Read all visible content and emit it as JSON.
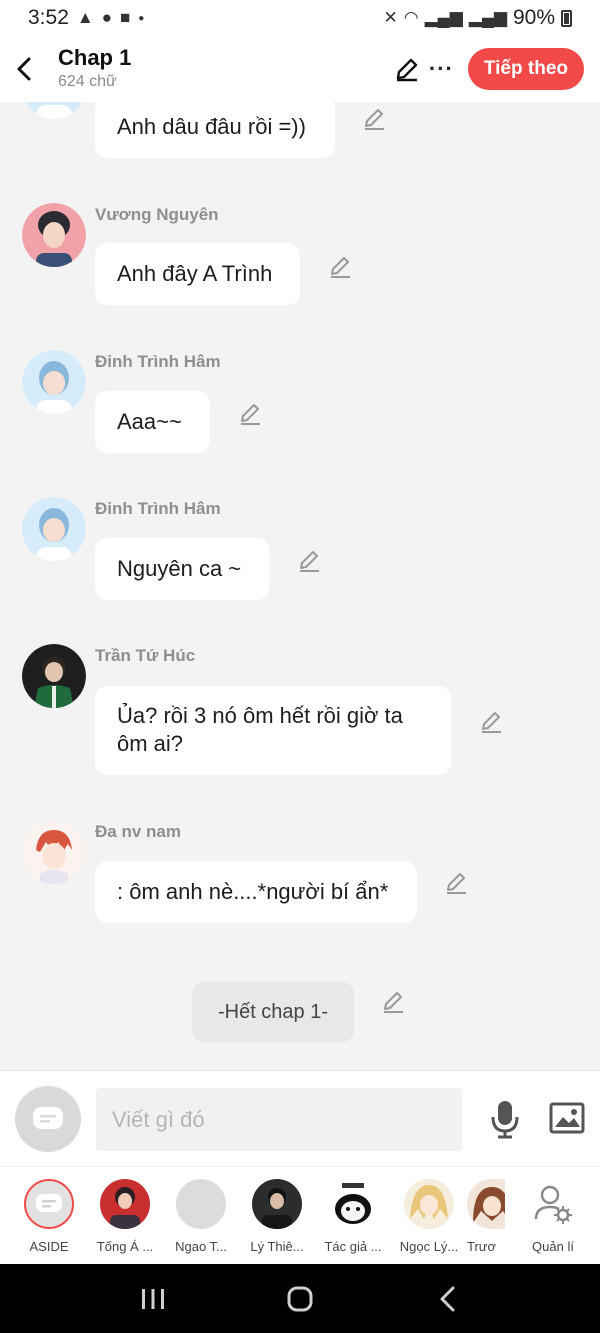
{
  "status_bar": {
    "time": "3:52",
    "battery": "90%",
    "notification_icons": [
      "warning-icon",
      "messenger-icon",
      "video-icon",
      "dot-icon"
    ],
    "system_icons": [
      "mute-icon",
      "wifi-icon",
      "signal-icon",
      "signal-icon",
      "battery-icon"
    ]
  },
  "header": {
    "title": "Chap 1",
    "subtitle": "624 chữ",
    "more": "···",
    "next_button": "Tiếp theo",
    "accent_color": "#f24a48"
  },
  "messages": [
    {
      "sender": "",
      "text": "Anh dâu đâu rồi =))",
      "avatar": "blue-hair-avatar"
    },
    {
      "sender": "Vương Nguyên",
      "text": "Anh đây A Trình",
      "avatar": "pink-avatar"
    },
    {
      "sender": "Đinh Trình Hâm",
      "text": "Aaa~~",
      "avatar": "blue-hair-avatar"
    },
    {
      "sender": "Đinh Trình Hâm",
      "text": "Nguyên ca ~",
      "avatar": "blue-hair-avatar"
    },
    {
      "sender": "Trần Tứ Húc",
      "text_lines": [
        "Ủa? rồi 3 nó ôm hết rồi giờ ta",
        "ôm ai?"
      ],
      "avatar": "green-jacket-avatar"
    },
    {
      "sender": "Đa nv nam",
      "text": ": ôm anh nè....*người bí ẩn*",
      "avatar": "anime-red-hair-avatar"
    }
  ],
  "end_marker": "-Hết chap 1-",
  "composer": {
    "placeholder": "Viết gì đó",
    "icons": [
      "message-icon",
      "microphone-icon",
      "image-icon"
    ]
  },
  "characters": [
    {
      "label": "ASIDE",
      "avatar": "aside-avatar"
    },
    {
      "label": "Tống Á ...",
      "avatar": "red-photo-avatar"
    },
    {
      "label": "Ngao T...",
      "avatar": "empty-avatar"
    },
    {
      "label": "Lý Thiê...",
      "avatar": "dark-photo-avatar"
    },
    {
      "label": "Tác giả ...",
      "avatar": "panda-meme-avatar"
    },
    {
      "label": "Ngọc Lý...",
      "avatar": "anime-blonde-avatar"
    },
    {
      "label": "Trươ",
      "avatar": "anime-brown-avatar"
    },
    {
      "label": "Quản lí",
      "avatar": "manage-user-icon"
    }
  ],
  "nav": [
    "recent-apps-icon",
    "home-icon",
    "back-icon"
  ]
}
